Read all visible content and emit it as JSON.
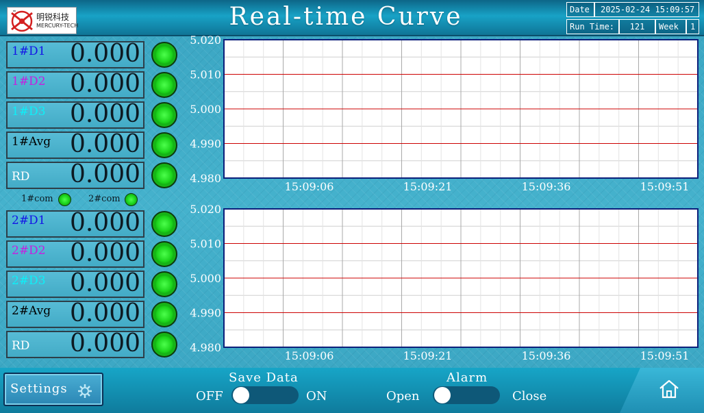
{
  "header": {
    "logo_cn": "明锐科技",
    "logo_en": "MERCURY-TECH",
    "title": "Real-time Curve",
    "date_label": "Date",
    "date_value": "2025-02-24 15:09:57",
    "runtime_label": "Run Time:",
    "runtime_value": "121",
    "week_label": "Week",
    "week_value": "1"
  },
  "group1": {
    "rows": [
      {
        "label": "1#D1",
        "value": "0.000",
        "color": "#1414e6"
      },
      {
        "label": "1#D2",
        "value": "0.000",
        "color": "#c51fe0"
      },
      {
        "label": "1#D3",
        "value": "0.000",
        "color": "#0df0f8"
      },
      {
        "label": "1#Avg",
        "value": "0.000",
        "color": "#000000"
      },
      {
        "label": "RD",
        "value": "0.000",
        "color": "#ffffff"
      }
    ]
  },
  "com": {
    "com1_label": "1#com",
    "com2_label": "2#com"
  },
  "group2": {
    "rows": [
      {
        "label": "2#D1",
        "value": "0.000",
        "color": "#1414e6"
      },
      {
        "label": "2#D2",
        "value": "0.000",
        "color": "#c51fe0"
      },
      {
        "label": "2#D3",
        "value": "0.000",
        "color": "#0df0f8"
      },
      {
        "label": "2#Avg",
        "value": "0.000",
        "color": "#000000"
      },
      {
        "label": "RD",
        "value": "0.000",
        "color": "#ffffff"
      }
    ]
  },
  "chart_data": [
    {
      "type": "line",
      "y_ticks": [
        "5.020",
        "5.010",
        "5.000",
        "4.990",
        "4.980"
      ],
      "x_ticks": [
        "15:09:06",
        "15:09:21",
        "15:09:36",
        "15:09:51"
      ],
      "ylim": [
        4.98,
        5.02
      ],
      "reference_lines": [
        5.01,
        5.0,
        4.99
      ],
      "reference_color": "#cc0000",
      "series": [],
      "grid": true
    },
    {
      "type": "line",
      "y_ticks": [
        "5.020",
        "5.010",
        "5.000",
        "4.990",
        "4.980"
      ],
      "x_ticks": [
        "15:09:06",
        "15:09:21",
        "15:09:36",
        "15:09:51"
      ],
      "ylim": [
        4.98,
        5.02
      ],
      "reference_lines": [
        5.01,
        5.0,
        4.99
      ],
      "reference_color": "#cc0000",
      "series": [],
      "grid": true
    }
  ],
  "footer": {
    "settings_label": "Settings",
    "save_title": "Save Data",
    "save_off": "OFF",
    "save_on": "ON",
    "save_state": "OFF",
    "alarm_title": "Alarm",
    "alarm_open": "Open",
    "alarm_close": "Close",
    "alarm_state": "Open"
  },
  "icons": {
    "settings": "gear-icon",
    "home": "home-icon",
    "logo": "logo-mark-icon"
  }
}
